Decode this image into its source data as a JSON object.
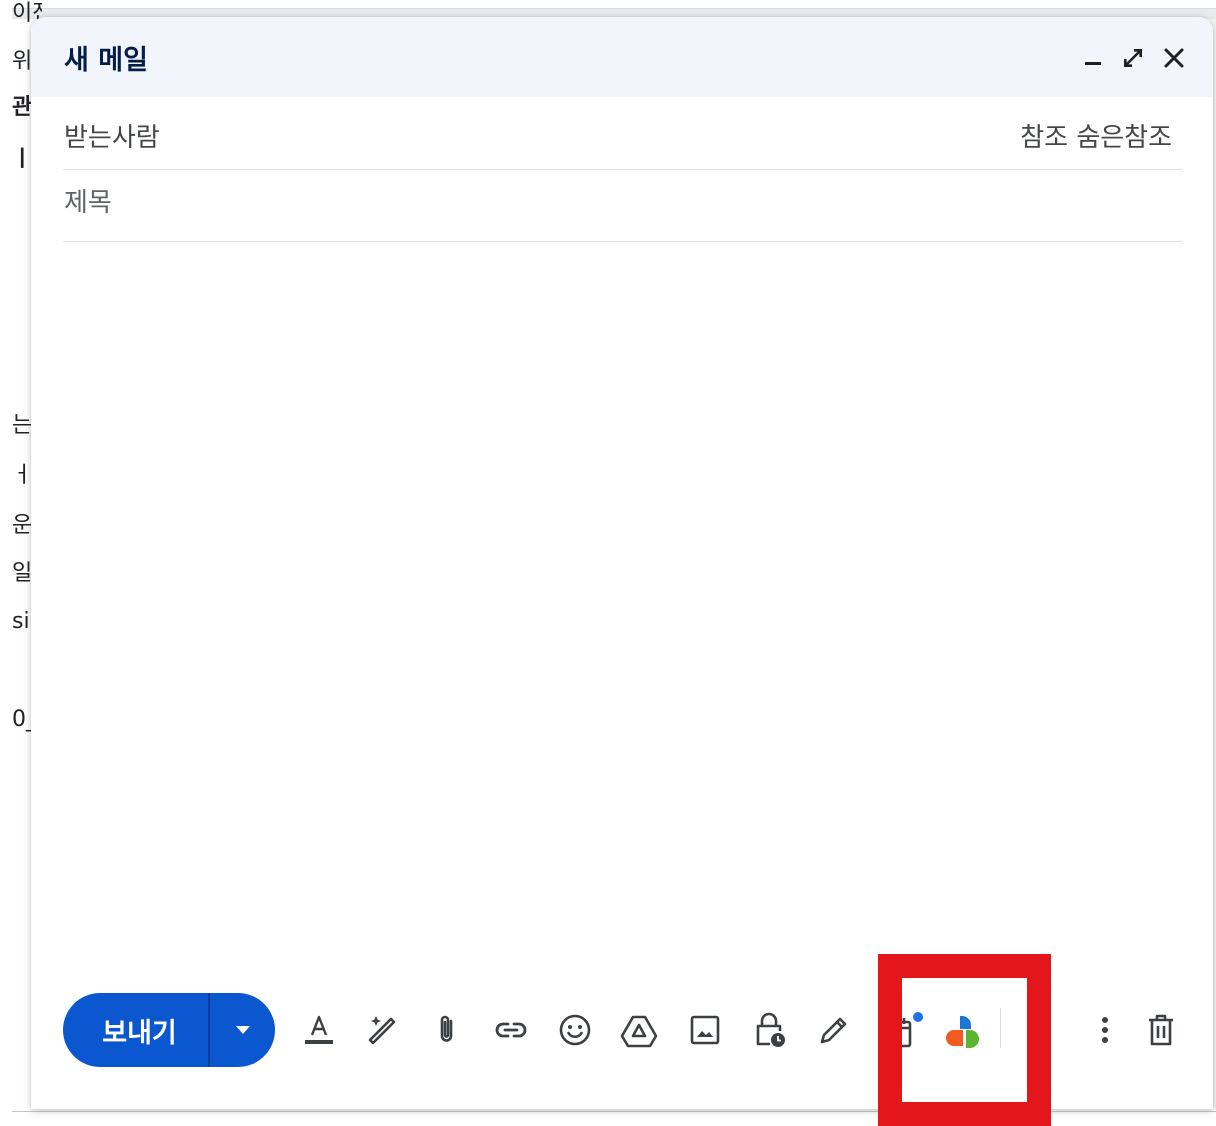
{
  "background_fragments": [
    "이전",
    "위한",
    "관한",
    "ㅣ",
    "는",
    "ㅓ",
    "운",
    "일",
    "sin",
    "0_"
  ],
  "compose": {
    "title": "새 메일",
    "header_buttons": {
      "minimize": "minimize-icon",
      "fullscreen": "expand-icon",
      "close": "close-icon"
    },
    "to_label": "받는사람",
    "cc_label": "참조",
    "bcc_label": "숨은참조",
    "subject_placeholder": "제목",
    "subject_value": "",
    "body": ""
  },
  "toolbar": {
    "send_label": "보내기",
    "send_options_icon": "caret-down-icon",
    "tools": [
      "text-format-icon",
      "magic-write-icon",
      "attach-icon",
      "link-icon",
      "emoji-icon",
      "drive-icon",
      "image-icon",
      "confidential-lock-icon",
      "signature-pen-icon",
      "calendar-icon",
      "extension-logo-icon",
      "more-options-icon",
      "delete-icon"
    ]
  },
  "colors": {
    "accent": "#0b57d0",
    "header_bg": "#f2f6fc",
    "title": "#041e49",
    "highlight_box": "#e3161b",
    "notification_dot": "#1a73e8",
    "logo_orange": "#f25a22",
    "logo_green": "#5cb531",
    "logo_blue": "#1976d2"
  }
}
